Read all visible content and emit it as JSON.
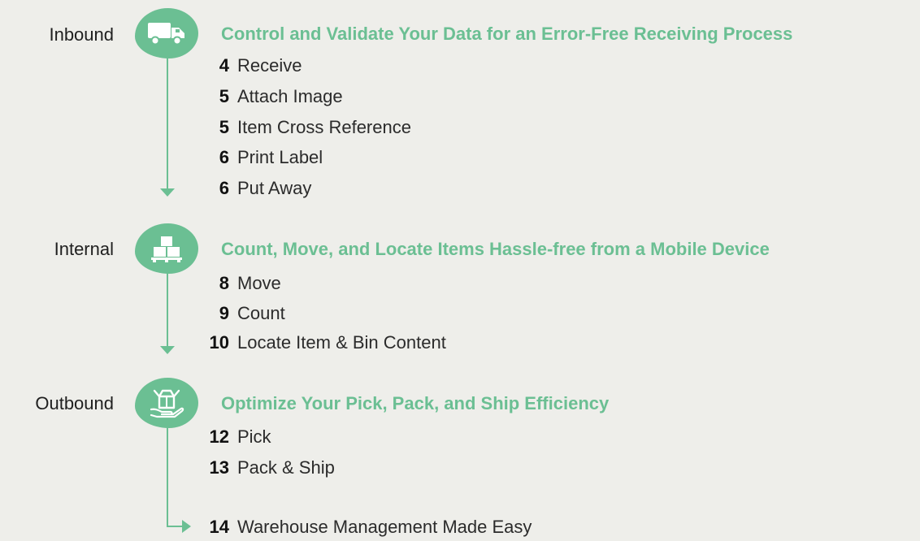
{
  "sections": [
    {
      "label": "Inbound",
      "icon": "truck-icon",
      "heading": "Control and Validate Your Data for an Error-Free Receiving Process",
      "items": [
        {
          "num": "4",
          "label": "Receive"
        },
        {
          "num": "5",
          "label": "Attach Image"
        },
        {
          "num": "5",
          "label": "Item Cross Reference"
        },
        {
          "num": "6",
          "label": "Print Label"
        },
        {
          "num": "6",
          "label": "Put Away"
        }
      ]
    },
    {
      "label": "Internal",
      "icon": "pallet-boxes-icon",
      "heading": "Count, Move, and Locate Items Hassle-free from a Mobile Device",
      "items": [
        {
          "num": "8",
          "label": "Move"
        },
        {
          "num": "9",
          "label": "Count"
        },
        {
          "num": "10",
          "label": "Locate Item & Bin Content"
        }
      ]
    },
    {
      "label": "Outbound",
      "icon": "open-box-hand-icon",
      "heading": "Optimize Your  Pick, Pack, and Ship Efficiency",
      "items": [
        {
          "num": "12",
          "label": "Pick"
        },
        {
          "num": "13",
          "label": "Pack & Ship"
        }
      ]
    }
  ],
  "final_item": {
    "num": "14",
    "label": "Warehouse Management Made Easy"
  },
  "colors": {
    "accent": "#6bbf93",
    "background": "#eeeeea",
    "text": "#1f1f1f"
  }
}
